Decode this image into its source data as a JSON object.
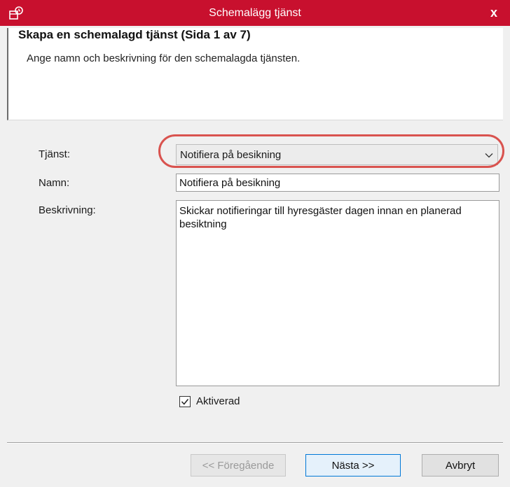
{
  "window": {
    "title": "Schemalägg tjänst",
    "close_label": "x",
    "title_bar_color": "#c8102e",
    "app_icon": "wizard-app-icon"
  },
  "header": {
    "title": "Skapa en schemalagd tjänst (Sida 1 av 7)",
    "subtitle": "Ange namn och beskrivning för den schemalagda tjänsten."
  },
  "form": {
    "service_label": "Tjänst:",
    "service_value": "Notifiera på besikning",
    "name_label": "Namn:",
    "name_value": "Notifiera på besikning",
    "description_label": "Beskrivning:",
    "description_value": "Skickar notifieringar till hyresgäster dagen innan en planerad besiktning",
    "enabled_label": "Aktiverad",
    "enabled_checked": true
  },
  "annotation": {
    "highlight_color": "#d9534f"
  },
  "footer": {
    "previous_label": "<< Föregående",
    "next_label": "Nästa >>",
    "cancel_label": "Avbryt"
  }
}
